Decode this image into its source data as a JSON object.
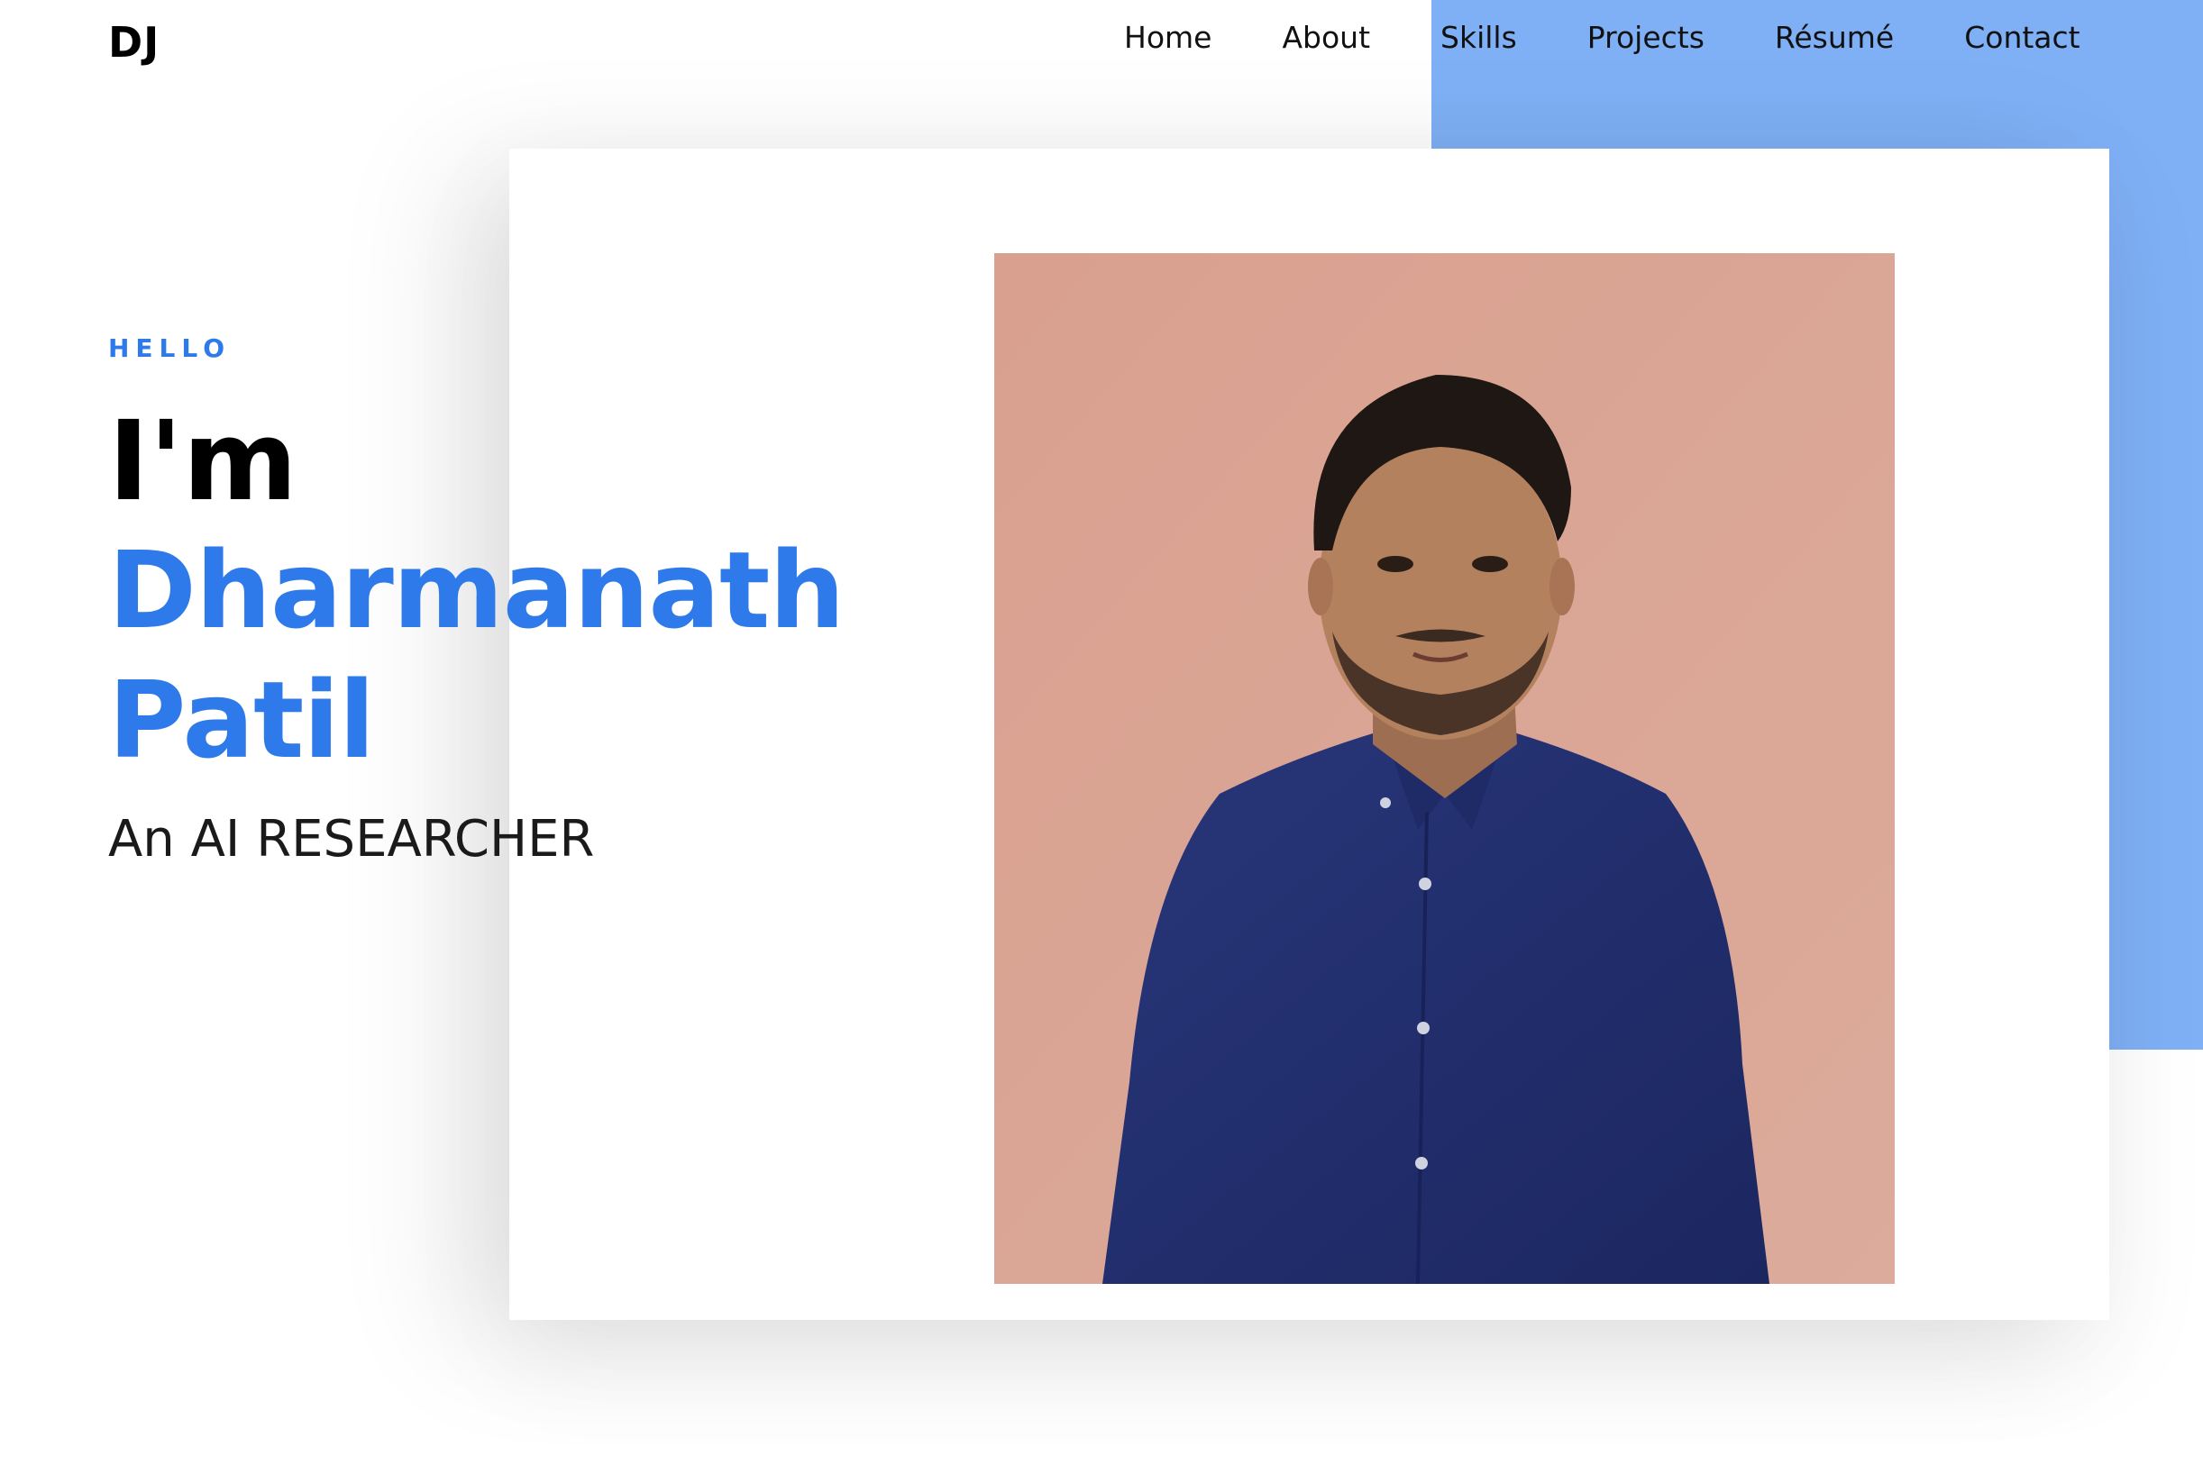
{
  "header": {
    "logo": "DJ",
    "nav": [
      {
        "label": "Home"
      },
      {
        "label": "About"
      },
      {
        "label": "Skills"
      },
      {
        "label": "Projects"
      },
      {
        "label": "Résumé"
      },
      {
        "label": "Contact"
      }
    ]
  },
  "hero": {
    "greeting": "HELLO",
    "intro": "I'm",
    "first_name": "Dharmanath",
    "last_name": "Patil",
    "role": "An AI RESEARCHER"
  },
  "colors": {
    "accent": "#2f7aeb",
    "block": "#7fb0f5",
    "photo_background": "#dba594",
    "shirt": "#23306b"
  }
}
